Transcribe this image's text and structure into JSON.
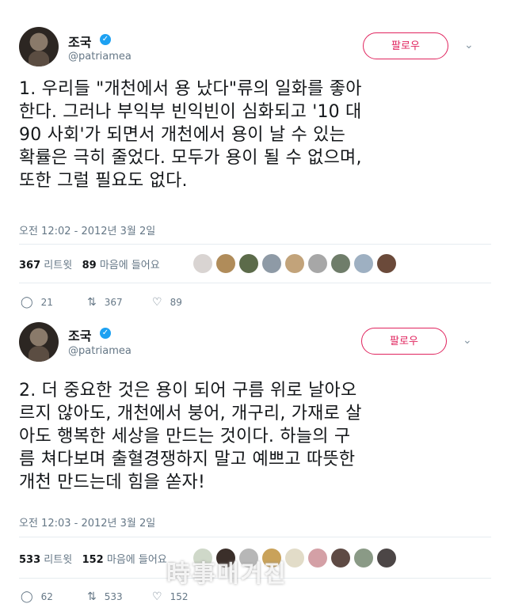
{
  "tweets": [
    {
      "name": "조국",
      "handle": "@patriamea",
      "follow_label": "팔로우",
      "text": "1. 우리들 \"개천에서 용 났다\"류의 일화를 좋아\n한다. 그러나 부익부 빈익빈이 심화되고 '10 대\n90 사회'가 되면서 개천에서 용이 날 수 있는\n확률은 극히 줄었다. 모두가 용이 될 수 없으며,\n또한 그럴 필요도 없다.",
      "timestamp": "오전 12:02 - 2012년 3월 2일",
      "retweets_count": "367",
      "retweets_label": "리트윗",
      "likes_count": "89",
      "likes_label": "마음에 들어요",
      "actions": {
        "replies": "21",
        "retweets": "367",
        "likes": "89"
      }
    },
    {
      "name": "조국",
      "handle": "@patriamea",
      "follow_label": "팔로우",
      "text": "2. 더 중요한 것은 용이 되어 구름 위로 날아오\n르지 않아도, 개천에서 붕어, 개구리, 가재로 살\n아도 행복한 세상을 만드는 것이다. 하늘의 구\n름 쳐다보며 출혈경쟁하지 말고 예쁘고 따뜻한\n개천 만드는데 힘을 쏟자!",
      "timestamp": "오전 12:03 - 2012년 3월 2일",
      "retweets_count": "533",
      "retweets_label": "리트윗",
      "likes_count": "152",
      "likes_label": "마음에 들어요",
      "actions": {
        "replies": "62",
        "retweets": "533",
        "likes": "152"
      }
    }
  ],
  "icons": {
    "verified": "verified-badge-icon",
    "chevron": "chevron-down-icon",
    "reply": "reply-icon",
    "retweet": "retweet-icon",
    "like": "heart-icon"
  },
  "colors": {
    "accent": "#e0245e",
    "verified": "#1da1f2",
    "muted": "#657786"
  },
  "watermark": "時事매거진"
}
